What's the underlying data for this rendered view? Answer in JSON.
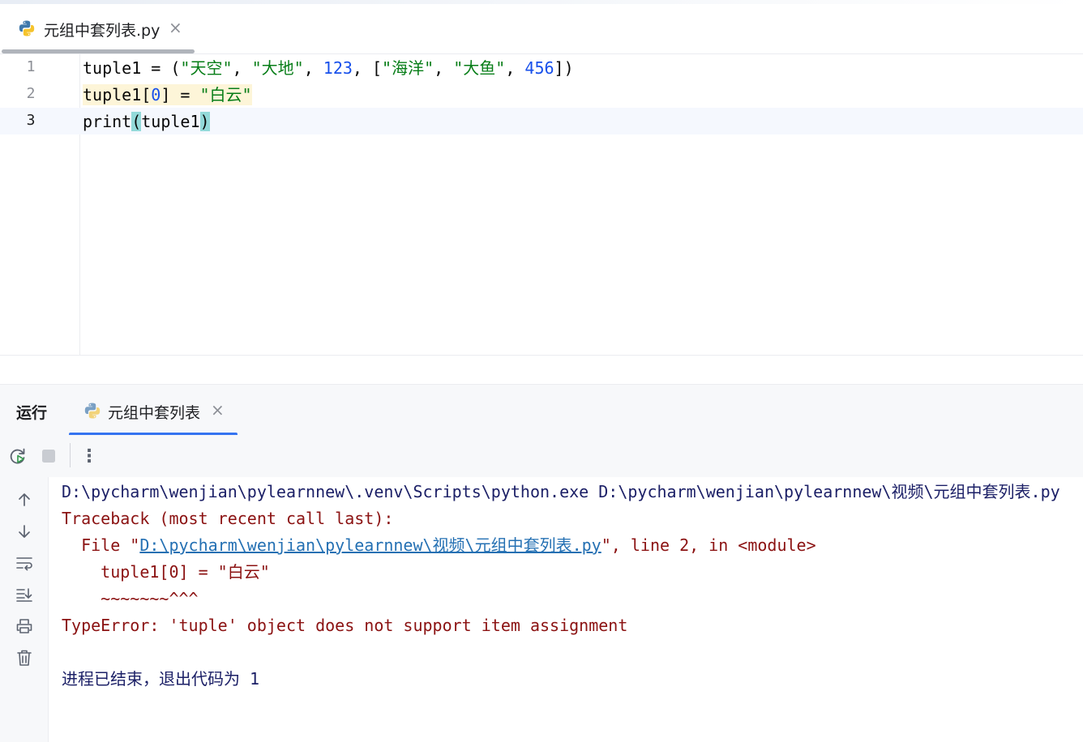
{
  "editor_tab": {
    "title": "元组中套列表.py",
    "close": "×",
    "icon": "python-file-icon"
  },
  "code_lines": [
    {
      "num": "1"
    },
    {
      "num": "2"
    },
    {
      "num": "3"
    }
  ],
  "code": {
    "l1": {
      "a": "tuple1 = (",
      "s1": "\"天空\"",
      "c1": ", ",
      "s2": "\"大地\"",
      "c2": ", ",
      "n1": "123",
      "c3": ", [",
      "s3": "\"海洋\"",
      "c4": ", ",
      "s4": "\"大鱼\"",
      "c5": ", ",
      "n2": "456",
      "c6": "])"
    },
    "l2": {
      "a": "tuple1[",
      "n": "0",
      "b": "] = ",
      "s": "\"白云\""
    },
    "l3": {
      "a": "print",
      "p1": "(",
      "b": "tuple1",
      "p2": ")"
    }
  },
  "run_panel": {
    "label": "运行",
    "tab_title": "元组中套列表",
    "tab_close": "×",
    "toolbar": {
      "rerun_icon": "rerun-icon",
      "stop_icon": "stop-icon",
      "more_label": "⋮"
    }
  },
  "console": {
    "line1": "D:\\pycharm\\wenjian\\pylearnnew\\.venv\\Scripts\\python.exe D:\\pycharm\\wenjian\\pylearnnew\\视频\\元组中套列表.py",
    "line2": "Traceback (most recent call last):",
    "line3_pre": "  File \"",
    "line3_link": "D:\\pycharm\\wenjian\\pylearnnew\\视频\\元组中套列表.py",
    "line3_post": "\", line 2, in <module>",
    "line4": "    tuple1[0] = \"白云\"",
    "line5": "    ~~~~~~~^^^",
    "line6": "TypeError: 'tuple' object does not support item assignment",
    "line7_text": "进程已结束，退出代码为 ",
    "line7_code": "1"
  },
  "colors": {
    "string": "#067d17",
    "number": "#1750eb",
    "error": "#8b1212",
    "link": "#2470b3",
    "accent": "#3574f0"
  }
}
